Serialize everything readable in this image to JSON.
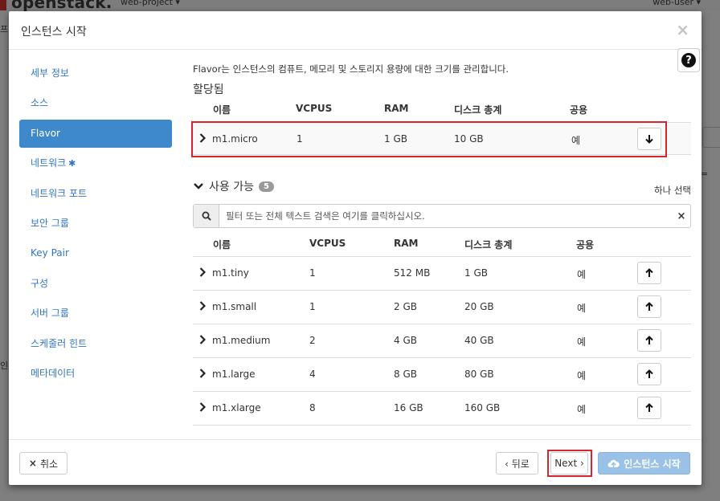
{
  "background": {
    "logo": "openstack.",
    "project": "web-project ▾",
    "user": "web-user ▾",
    "frag1": "프",
    "frag2": "인"
  },
  "modal": {
    "title": "인스턴스 시작",
    "close_glyph": "×",
    "help_glyph": "?"
  },
  "sidebar": {
    "items": [
      {
        "label": "세부 정보"
      },
      {
        "label": "소스"
      },
      {
        "label": "Flavor"
      },
      {
        "label": "네트워크",
        "required": "✱"
      },
      {
        "label": "네트워크 포트"
      },
      {
        "label": "보안 그룹"
      },
      {
        "label": "Key Pair"
      },
      {
        "label": "구성"
      },
      {
        "label": "서버 그룹"
      },
      {
        "label": "스케줄러 힌트"
      },
      {
        "label": "메타데이터"
      }
    ]
  },
  "flavor": {
    "description": "Flavor는 인스턴스의 컴퓨트, 메모리 및 스토리지 용량에 대한 크기를 관리합니다.",
    "allocated_title": "할당됨",
    "columns": {
      "name": "이름",
      "vcpus": "VCPUS",
      "ram": "RAM",
      "disk": "디스크 총계",
      "public": "공용"
    },
    "allocated": [
      {
        "name": "m1.micro",
        "vcpus": "1",
        "ram": "1 GB",
        "disk": "10 GB",
        "public": "예"
      }
    ],
    "available_title": "사용 가능",
    "available_count": "5",
    "select_one": "하나 선택",
    "filter_placeholder": "필터 또는 전체 텍스트 검색은 여기를 클릭하십시오.",
    "filter_clear": "×",
    "available": [
      {
        "name": "m1.tiny",
        "vcpus": "1",
        "ram": "512 MB",
        "disk": "1 GB",
        "public": "예"
      },
      {
        "name": "m1.small",
        "vcpus": "1",
        "ram": "2 GB",
        "disk": "20 GB",
        "public": "예"
      },
      {
        "name": "m1.medium",
        "vcpus": "2",
        "ram": "4 GB",
        "disk": "40 GB",
        "public": "예"
      },
      {
        "name": "m1.large",
        "vcpus": "4",
        "ram": "8 GB",
        "disk": "80 GB",
        "public": "예"
      },
      {
        "name": "m1.xlarge",
        "vcpus": "8",
        "ram": "16 GB",
        "disk": "160 GB",
        "public": "예"
      }
    ]
  },
  "footer": {
    "cancel_icon": "×",
    "cancel_label": "취소",
    "back_label": "‹ 뒤로",
    "next_label": "Next ›",
    "launch_label": "인스턴스 시작"
  },
  "colors": {
    "accent": "#3d89cc",
    "highlight": "#d9232e",
    "launch_disabled": "#99c2e6"
  }
}
